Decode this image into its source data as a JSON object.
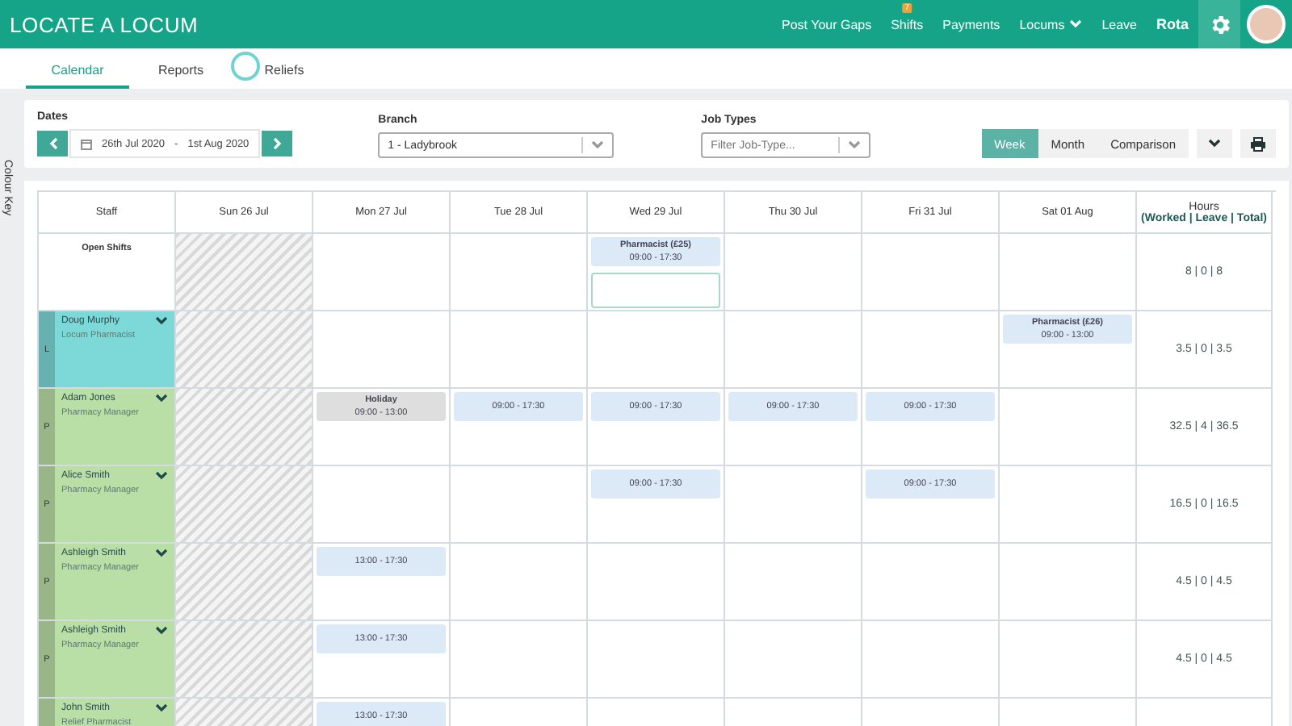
{
  "header": {
    "logo": "LOCATE A LOCUM",
    "nav": [
      {
        "label": "Post Your Gaps",
        "selected": false
      },
      {
        "label": "Shifts",
        "selected": false,
        "badge": "7"
      },
      {
        "label": "Payments",
        "selected": false
      },
      {
        "label": "Locums",
        "selected": false,
        "dropdown": true
      },
      {
        "label": "Leave",
        "selected": false
      },
      {
        "label": "Rota",
        "selected": true
      }
    ]
  },
  "tabs": [
    {
      "label": "Calendar",
      "selected": true
    },
    {
      "label": "Reports",
      "selected": false
    },
    {
      "label": "Reliefs",
      "selected": false
    }
  ],
  "colour_key": {
    "label": "Colour Key"
  },
  "filters": {
    "dates": {
      "label": "Dates",
      "from": "26th Jul 2020",
      "separator": "-",
      "to": "1st Aug 2020"
    },
    "branch": {
      "label": "Branch",
      "value": "1 - Ladybrook"
    },
    "job_types": {
      "label": "Job Types",
      "placeholder": "Filter Job-Type..."
    },
    "views": [
      {
        "label": "Week",
        "selected": true
      },
      {
        "label": "Month",
        "selected": false
      },
      {
        "label": "Comparison",
        "selected": false
      }
    ]
  },
  "table": {
    "staff_heading": "Staff",
    "columns": [
      "Sun 26 Jul",
      "Mon 27 Jul",
      "Tue 28 Jul",
      "Wed 29 Jul",
      "Thu 30 Jul",
      "Fri 31 Jul",
      "Sat 01 Aug"
    ],
    "hours_heading": "Hours",
    "hours_subheading": "(Worked | Leave | Total)",
    "rows": [
      {
        "kind": "open",
        "name": "Open Shifts",
        "hours": "8 | 0 | 8",
        "cells": [
          {
            "disabled": true
          },
          {
            "disabled": false
          },
          {
            "disabled": false
          },
          {
            "disabled": false,
            "shifts": [
              {
                "kind": "shift",
                "title": "Pharmacist (£25)",
                "time": "09:00 - 17:30"
              },
              {
                "kind": "slot"
              }
            ]
          },
          {
            "disabled": false
          },
          {
            "disabled": false
          },
          {
            "disabled": false
          }
        ]
      },
      {
        "kind": "staff",
        "name": "Doug Murphy",
        "role": "Locum Pharmacist",
        "type": "L",
        "color": "#7dd8d8",
        "hours": "3.5 | 0 | 3.5",
        "cells": [
          {
            "disabled": true
          },
          {
            "disabled": false
          },
          {
            "disabled": false
          },
          {
            "disabled": false
          },
          {
            "disabled": false
          },
          {
            "disabled": false
          },
          {
            "disabled": false,
            "shifts": [
              {
                "kind": "shift",
                "title": "Pharmacist (£26)",
                "time": "09:00 - 13:00"
              }
            ]
          }
        ]
      },
      {
        "kind": "staff",
        "name": "Adam Jones",
        "role": "Pharmacy Manager",
        "type": "P",
        "color": "#b9dea6",
        "hours": "32.5 | 4 | 36.5",
        "cells": [
          {
            "disabled": true
          },
          {
            "disabled": false,
            "shifts": [
              {
                "kind": "holiday",
                "title": "Holiday",
                "time": "09:00 - 13:00"
              }
            ]
          },
          {
            "disabled": false,
            "shifts": [
              {
                "kind": "shift",
                "time": "09:00 - 17:30"
              }
            ]
          },
          {
            "disabled": false,
            "shifts": [
              {
                "kind": "shift",
                "time": "09:00 - 17:30"
              }
            ]
          },
          {
            "disabled": false,
            "shifts": [
              {
                "kind": "shift",
                "time": "09:00 - 17:30"
              }
            ]
          },
          {
            "disabled": false,
            "shifts": [
              {
                "kind": "shift",
                "time": "09:00 - 17:30"
              }
            ]
          },
          {
            "disabled": false
          }
        ]
      },
      {
        "kind": "staff",
        "name": "Alice Smith",
        "role": "Pharmacy Manager",
        "type": "P",
        "color": "#b9dea6",
        "hours": "16.5 | 0 | 16.5",
        "cells": [
          {
            "disabled": true
          },
          {
            "disabled": false
          },
          {
            "disabled": false
          },
          {
            "disabled": false,
            "shifts": [
              {
                "kind": "shift",
                "time": "09:00 - 17:30"
              }
            ]
          },
          {
            "disabled": false
          },
          {
            "disabled": false,
            "shifts": [
              {
                "kind": "shift",
                "time": "09:00 - 17:30"
              }
            ]
          },
          {
            "disabled": false
          }
        ]
      },
      {
        "kind": "staff",
        "name": "Ashleigh Smith",
        "role": "Pharmacy Manager",
        "type": "P",
        "color": "#b9dea6",
        "hours": "4.5 | 0 | 4.5",
        "cells": [
          {
            "disabled": true
          },
          {
            "disabled": false,
            "shifts": [
              {
                "kind": "shift",
                "time": "13:00 - 17:30"
              }
            ]
          },
          {
            "disabled": false
          },
          {
            "disabled": false
          },
          {
            "disabled": false
          },
          {
            "disabled": false
          },
          {
            "disabled": false
          }
        ]
      },
      {
        "kind": "staff",
        "name": "Ashleigh Smith",
        "role": "Pharmacy Manager",
        "type": "P",
        "color": "#b9dea6",
        "hours": "4.5 | 0 | 4.5",
        "cells": [
          {
            "disabled": true
          },
          {
            "disabled": false,
            "shifts": [
              {
                "kind": "shift",
                "time": "13:00 - 17:30"
              }
            ]
          },
          {
            "disabled": false
          },
          {
            "disabled": false
          },
          {
            "disabled": false
          },
          {
            "disabled": false
          },
          {
            "disabled": false
          }
        ]
      },
      {
        "kind": "staff",
        "name": "John Smith",
        "role": "Relief Pharmacist",
        "color": "#b9dea6",
        "cells": [
          {
            "disabled": true
          },
          {
            "disabled": false,
            "shifts": [
              {
                "kind": "shift",
                "time": "13:00 - 17:30"
              }
            ]
          },
          {
            "disabled": false
          },
          {
            "disabled": false
          },
          {
            "disabled": false
          },
          {
            "disabled": false
          },
          {
            "disabled": false
          }
        ]
      }
    ]
  }
}
